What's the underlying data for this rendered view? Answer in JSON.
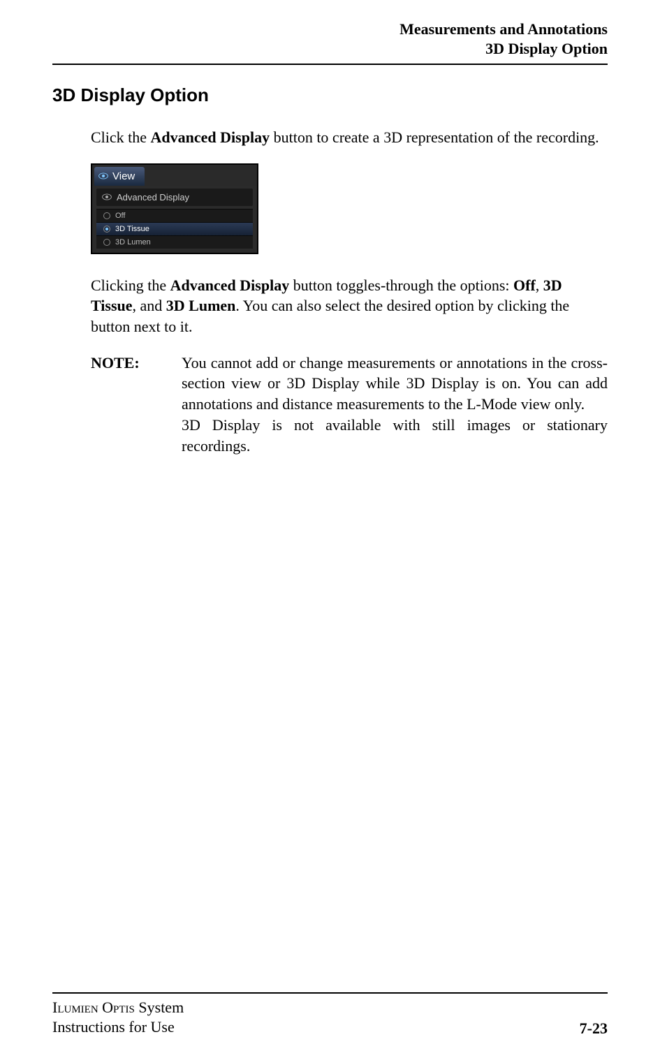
{
  "header": {
    "line1": "Measurements and Annotations",
    "line2": "3D Display Option"
  },
  "section_title": "3D Display Option",
  "intro": {
    "pre": "Click the ",
    "bold": "Advanced Display",
    "post": " button to create a 3D representation of the recording."
  },
  "ui": {
    "tab_label": "View",
    "main_row": "Advanced Display",
    "rows": [
      {
        "label": "Off",
        "selected": false
      },
      {
        "label": "3D Tissue",
        "selected": true
      },
      {
        "label": "3D Lumen",
        "selected": false
      }
    ]
  },
  "toggle_para": {
    "t1": "Clicking the ",
    "b1": "Advanced Display",
    "t2": " button toggles-through the options: ",
    "b2": "Off",
    "t3": ", ",
    "b3": "3D Tissue",
    "t4": ", and ",
    "b4": "3D Lumen",
    "t5": ". You can also select the desired option by clicking the button next to it."
  },
  "note": {
    "label": "NOTE:",
    "body": "You cannot add or change measurements or annotations in the cross-section view or 3D Display while 3D Display is on. You can add annotations and distance measurements to the L-Mode view only.\n3D Display is not available with still images or stationary recordings."
  },
  "footer": {
    "system_line1_sc1": "Ilumien",
    "system_line1_sc2": "Optis",
    "system_line1_tail": " System",
    "system_line2": "Instructions for Use",
    "page": "7-23"
  }
}
